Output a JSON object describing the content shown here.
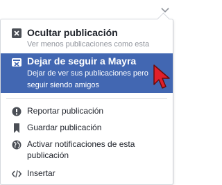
{
  "menu": {
    "hide_post": {
      "title": "Ocultar publicación",
      "subtitle": "Ver menos publicaciones como esta"
    },
    "unfollow": {
      "title": "Dejar de seguir a Mayra",
      "desc_line1": "Dejar de ver sus publicaciones pero",
      "desc_line2": "seguir siendo amigos"
    },
    "report": "Reportar publicación",
    "save": "Guardar publicación",
    "notifications_line1": "Activar notificaciones de esta",
    "notifications_line2": "publicación",
    "embed": "Insertar"
  },
  "colors": {
    "highlight": "#4267b2",
    "text": "#1d2129",
    "muted": "#90949c",
    "cursor": "#e0202a"
  },
  "icons": [
    "chevron-down-icon",
    "hide-icon",
    "unfollow-icon",
    "report-icon",
    "bookmark-icon",
    "globe-icon",
    "embed-icon",
    "mouse-cursor-icon"
  ]
}
